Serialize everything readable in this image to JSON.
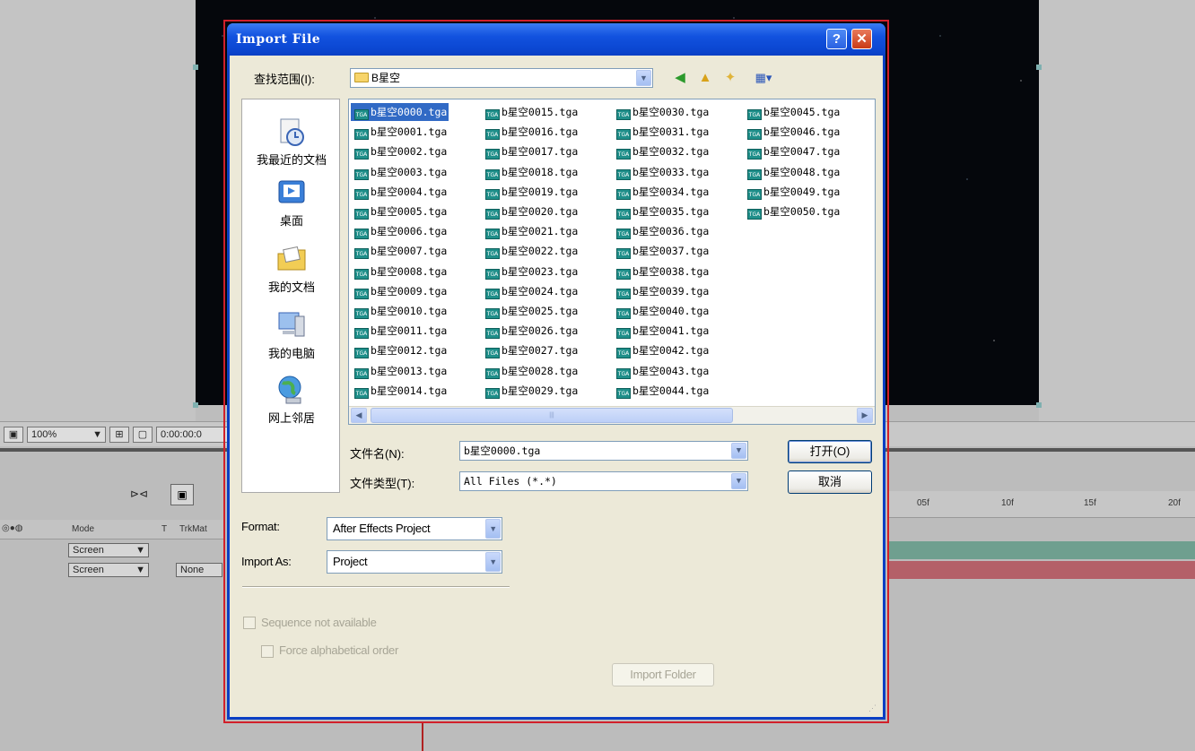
{
  "background": {
    "zoom": "100%",
    "timecode": "0:00:00:0",
    "mode_col": "Mode",
    "t_col": "T",
    "trkmat_col": "TrkMat",
    "layer_modes": [
      "Screen",
      "Screen"
    ],
    "trkmat_value": "None",
    "ruler_ticks": [
      "05f",
      "10f",
      "15f",
      "20f"
    ]
  },
  "dialog": {
    "title": "Import File",
    "help": "?",
    "close": "✕",
    "look_in_label": "查找范围(I):",
    "look_in_value": "B星空",
    "places": [
      "我最近的文档",
      "桌面",
      "我的文档",
      "我的电脑",
      "网上邻居"
    ],
    "files_col1": [
      "b星空0000.tga",
      "b星空0001.tga",
      "b星空0002.tga",
      "b星空0003.tga",
      "b星空0004.tga",
      "b星空0005.tga",
      "b星空0006.tga",
      "b星空0007.tga",
      "b星空0008.tga",
      "b星空0009.tga",
      "b星空0010.tga",
      "b星空0011.tga",
      "b星空0012.tga",
      "b星空0013.tga",
      "b星空0014.tga"
    ],
    "files_col2": [
      "b星空0015.tga",
      "b星空0016.tga",
      "b星空0017.tga",
      "b星空0018.tga",
      "b星空0019.tga",
      "b星空0020.tga",
      "b星空0021.tga",
      "b星空0022.tga",
      "b星空0023.tga",
      "b星空0024.tga",
      "b星空0025.tga",
      "b星空0026.tga",
      "b星空0027.tga",
      "b星空0028.tga",
      "b星空0029.tga"
    ],
    "files_col3": [
      "b星空0030.tga",
      "b星空0031.tga",
      "b星空0032.tga",
      "b星空0033.tga",
      "b星空0034.tga",
      "b星空0035.tga",
      "b星空0036.tga",
      "b星空0037.tga",
      "b星空0038.tga",
      "b星空0039.tga",
      "b星空0040.tga",
      "b星空0041.tga",
      "b星空0042.tga",
      "b星空0043.tga",
      "b星空0044.tga"
    ],
    "files_col4": [
      "b星空0045.tga",
      "b星空0046.tga",
      "b星空0047.tga",
      "b星空0048.tga",
      "b星空0049.tga",
      "b星空0050.tga"
    ],
    "file_badge": "TGA",
    "filename_label": "文件名(N):",
    "filename_value": "b星空0000.tga",
    "filetype_label": "文件类型(T):",
    "filetype_value": "All Files (*.*)",
    "open_button": "打开(O)",
    "cancel_button": "取消",
    "format_label": "Format:",
    "format_value": "After Effects Project",
    "import_as_label": "Import As:",
    "import_as_value": "Project",
    "sequence_label": "Sequence not available",
    "force_alpha_label": "Force alphabetical order",
    "import_folder_button": "Import Folder"
  },
  "colors": {
    "title_bar": "#0a3fc4",
    "selection": "#316ac5",
    "outline": "#d2202a"
  }
}
